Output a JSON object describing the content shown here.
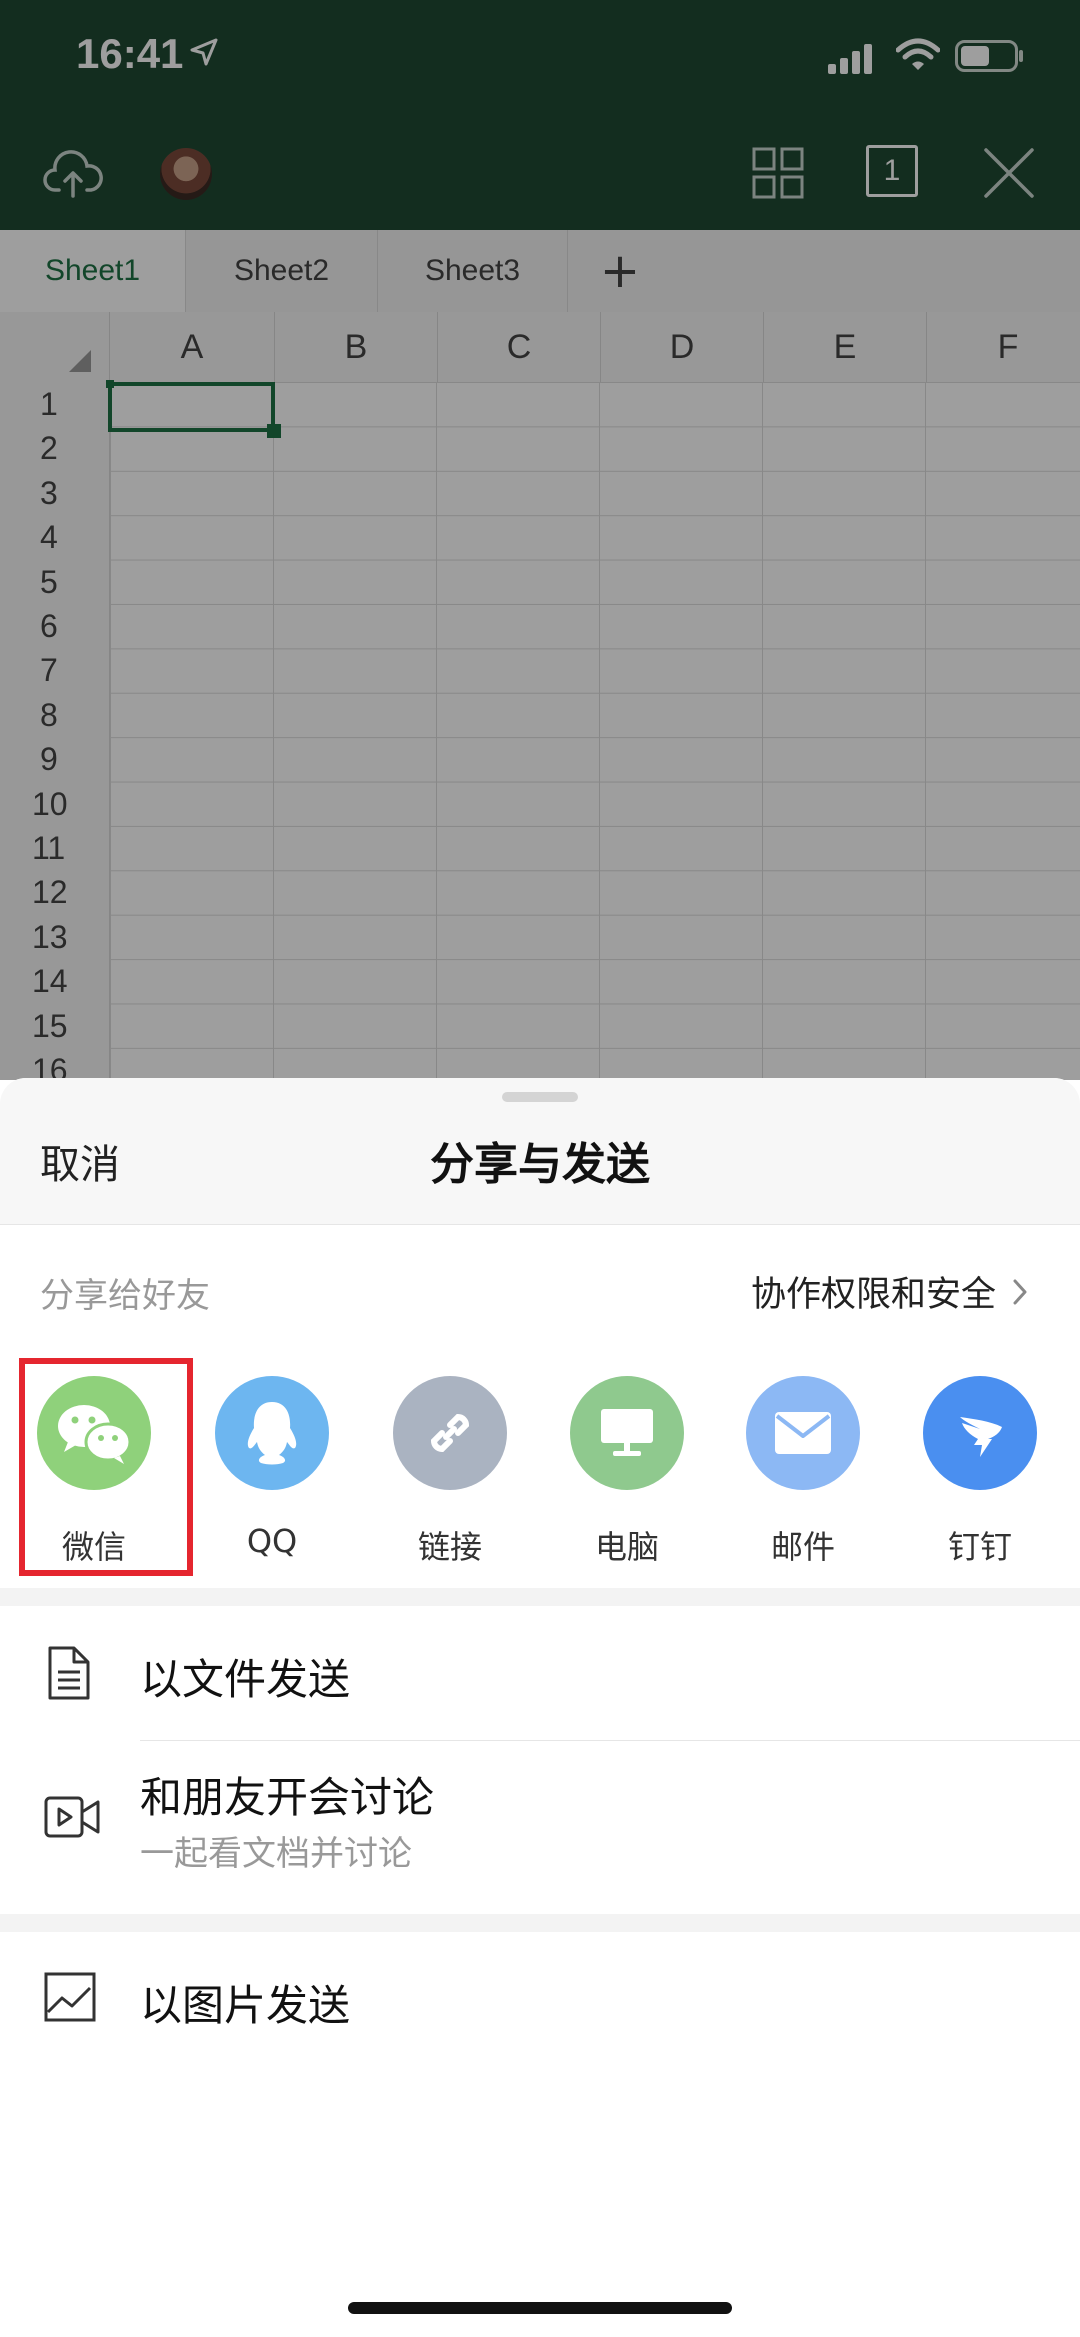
{
  "status_bar": {
    "time": "16:41"
  },
  "toolbar": {
    "page_count": "1"
  },
  "sheet": {
    "tabs": [
      "Sheet1",
      "Sheet2",
      "Sheet3"
    ],
    "add_tab": "+",
    "columns": [
      "A",
      "B",
      "C",
      "D",
      "E",
      "F"
    ],
    "rows": [
      "1",
      "2",
      "3",
      "4",
      "5",
      "6",
      "7",
      "8",
      "9",
      "10",
      "11",
      "12",
      "13",
      "14",
      "15",
      "16"
    ]
  },
  "share_sheet": {
    "cancel": "取消",
    "title": "分享与发送",
    "share_to_friends": "分享给好友",
    "permissions_link": "协作权限和安全",
    "apps": [
      {
        "label": "微信",
        "icon": "wechat-icon",
        "color": "#8fd17b"
      },
      {
        "label": "QQ",
        "icon": "qq-icon",
        "color": "#6db6f0"
      },
      {
        "label": "链接",
        "icon": "link-icon",
        "color": "#aab3c1"
      },
      {
        "label": "电脑",
        "icon": "computer-icon",
        "color": "#8fc98e"
      },
      {
        "label": "邮件",
        "icon": "mail-icon",
        "color": "#8cb8f4"
      },
      {
        "label": "钉钉",
        "icon": "dingtalk-icon",
        "color": "#4a8ff0"
      }
    ],
    "actions": {
      "send_file": "以文件发送",
      "meeting_title": "和朋友开会讨论",
      "meeting_sub": "一起看文档并讨论",
      "send_image": "以图片发送"
    },
    "highlight_color": "#e5262f"
  },
  "colors": {
    "header_green": "#204a33",
    "accent_green": "#1e7145"
  }
}
